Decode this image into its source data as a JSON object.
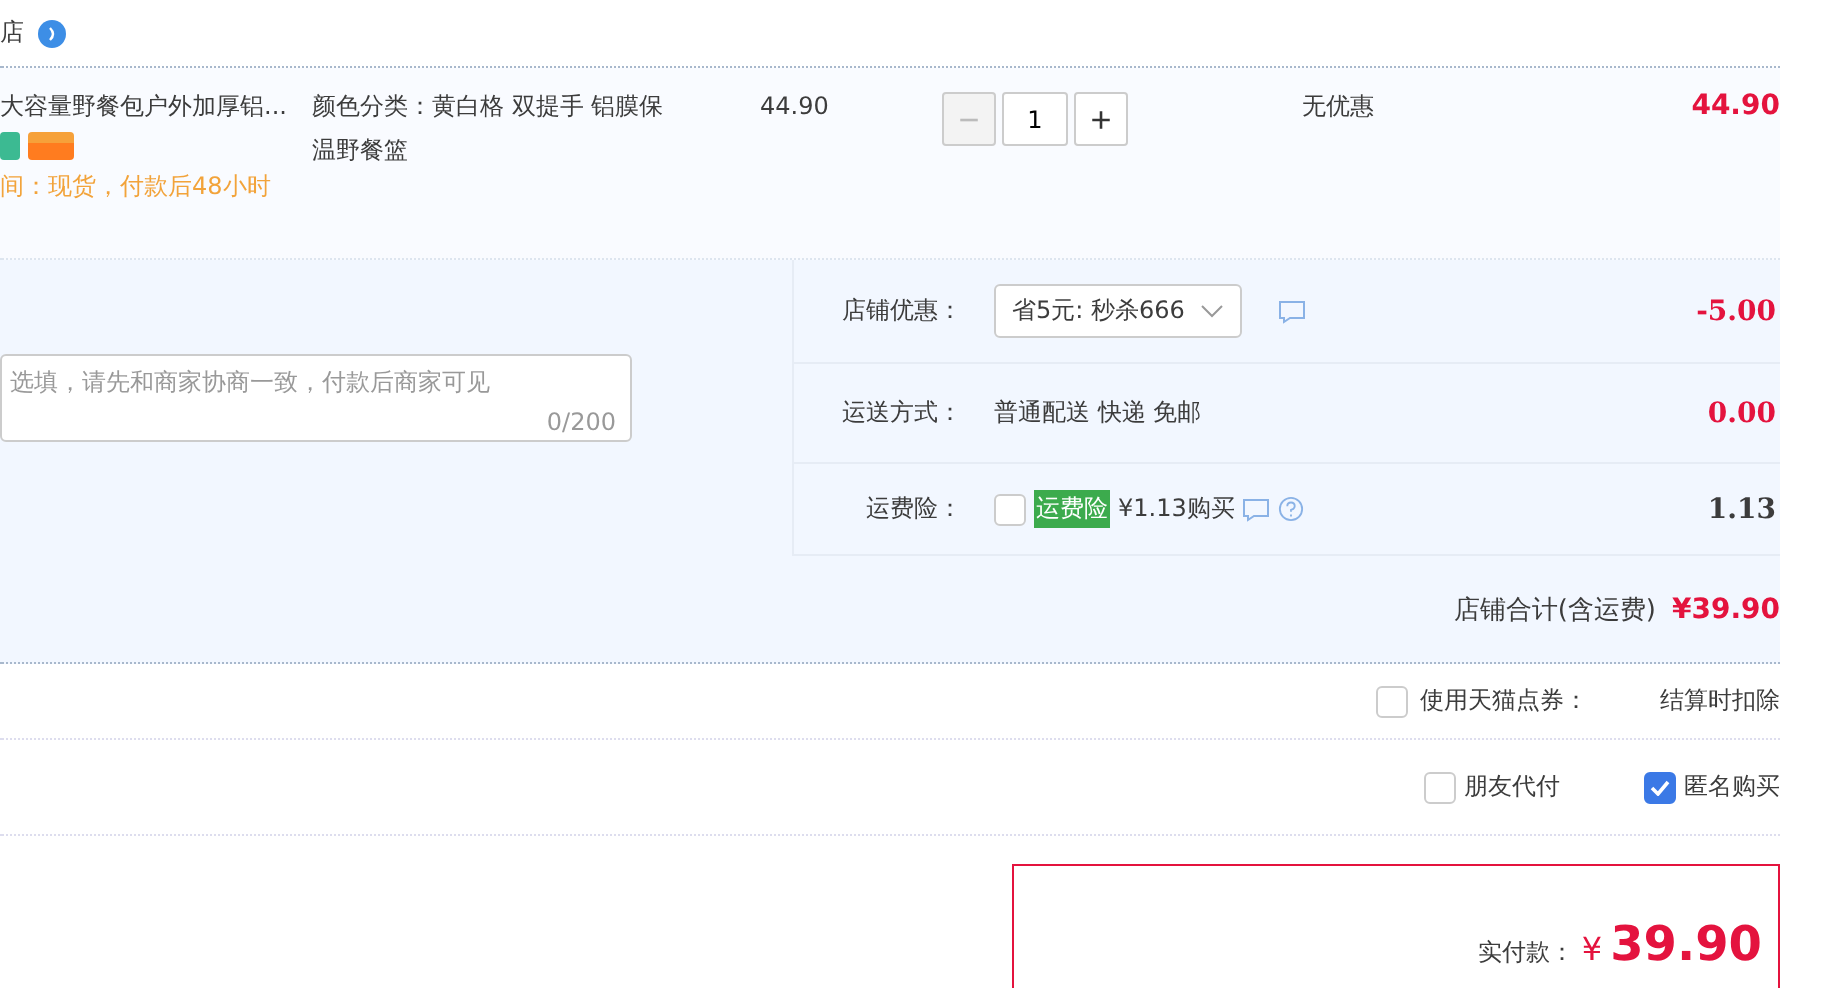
{
  "shop": {
    "name": "店"
  },
  "item": {
    "title": "大容量野餐包户外加厚铝...",
    "badges": [
      {
        "kind": "green"
      },
      {
        "kind": "card"
      }
    ],
    "delivery_lines": [
      "间：现货，付款后48小时"
    ],
    "sku_lines": [
      "颜色分类：黄白格 双提手 铝膜保",
      "温野餐篮"
    ],
    "price": "44.90",
    "quantity": "1",
    "minus": "−",
    "plus": "+",
    "minus_disabled": true,
    "discount": "无优惠",
    "total": "44.90"
  },
  "message": {
    "placeholder": "选填，请先和商家协商一致，付款后商家可见",
    "counter": "0/200"
  },
  "options": [
    {
      "kind": "select",
      "label": "店铺优惠：",
      "value": "省5元: 秒杀666",
      "amount": "-5.00",
      "amount_red": true
    },
    {
      "kind": "text",
      "label": "运送方式：",
      "value": "普通配送 快递 免邮",
      "amount": "0.00",
      "amount_red": true
    },
    {
      "kind": "insurance",
      "label": "运费险：",
      "tag": "运费险",
      "value": "¥1.13购买",
      "checked": false,
      "amount": "1.13",
      "amount_red": false
    }
  ],
  "shop_total": {
    "label": "店铺合计(含运费)",
    "value": "¥39.90"
  },
  "points": {
    "label": "使用天猫点券：",
    "checked": false,
    "note": "结算时扣除"
  },
  "pay_options": [
    {
      "label": "朋友代付",
      "checked": false
    },
    {
      "label": "匿名购买",
      "checked": true
    }
  ],
  "final": {
    "label": "实付款：",
    "currency": "¥",
    "value": "39.90"
  }
}
